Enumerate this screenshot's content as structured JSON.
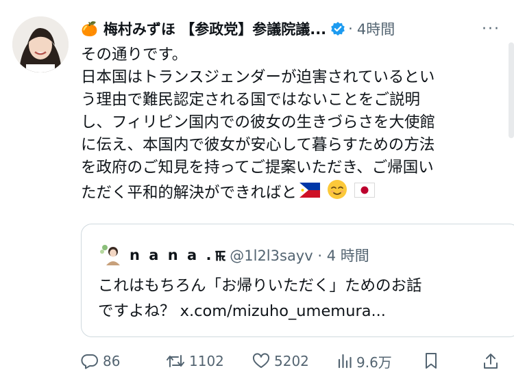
{
  "author": {
    "emoji": "🍊",
    "name": "梅村みずほ 【参政党】参議院議...",
    "time": "4時間",
    "more": "···"
  },
  "body_lines": [
    "その通りです。",
    "日本国はトランスジェンダーが迫害されているとい",
    "う理由で難民認定される国ではないことをご説明",
    "し、フィリピン国内での彼女の生きづらさを大使館",
    "に伝え、本国内で彼女が安心して暮らすための方法",
    "を政府のご知見を持ってご提案いただき、ご帰国い",
    "ただく平和的解決ができればと"
  ],
  "body_emojis": [
    "🇵🇭",
    "😌",
    "🇯🇵"
  ],
  "quote": {
    "name": "n a n a .",
    "name_suffix": "ꯃ",
    "handle": "@1l2l3sayv · 4 時間",
    "lines": [
      "これはもちろん「お帰りいただく」ためのお話",
      "ですよね？ x.com/mizuho_umemura..."
    ]
  },
  "actions": {
    "replies": "86",
    "reposts": "1102",
    "likes": "5202",
    "views": "9.6万"
  },
  "colors": {
    "text": "#0f1419",
    "secondary": "#536471",
    "verified": "#1d9bf0",
    "border": "#cfd9de"
  }
}
